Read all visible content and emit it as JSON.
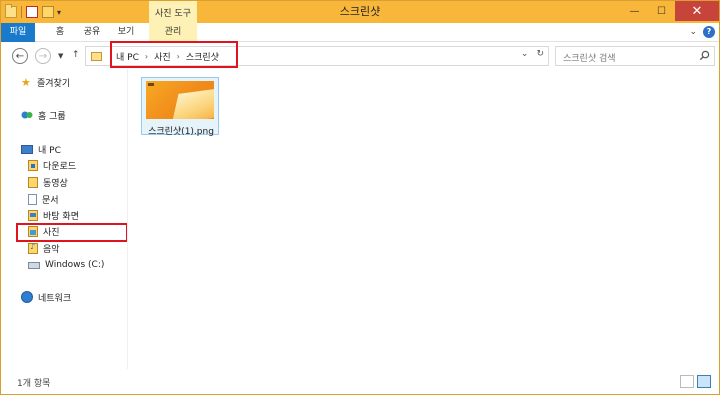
{
  "window": {
    "title": "스크린샷",
    "contextual_tab_group": "사진 도구",
    "minimize_glyph": "—",
    "maximize_glyph": "☐",
    "close_glyph": "✕"
  },
  "ribbon": {
    "tabs": [
      {
        "label": "파일",
        "active": true
      },
      {
        "label": "홈"
      },
      {
        "label": "공유"
      },
      {
        "label": "보기"
      },
      {
        "label": "관리",
        "contextual": true
      }
    ],
    "collapse_glyph": "⌄",
    "help_glyph": "?"
  },
  "address": {
    "crumbs": [
      "내 PC",
      "사진",
      "스크린샷"
    ],
    "separator": "›",
    "refresh_glyph": "↻",
    "dropdown_glyph": "⌄"
  },
  "search": {
    "placeholder": "스크린샷 검색"
  },
  "nav": {
    "favorites": "즐겨찾기",
    "homegroup": "홈 그룹",
    "this_pc": "내 PC",
    "downloads": "다운로드",
    "videos": "동영상",
    "documents": "문서",
    "desktop": "바탕 화면",
    "pictures": "사진",
    "music": "음악",
    "drive_c": "Windows (C:)",
    "network": "네트워크"
  },
  "files": [
    {
      "name": "스크린샷(1).png",
      "selected": true
    }
  ],
  "status": {
    "item_count": "1개 항목"
  },
  "colors": {
    "title_bar": "#f8b63a",
    "file_tab": "#1979ca",
    "highlight_box": "#e0141e",
    "selection": "#e5f3fb"
  }
}
